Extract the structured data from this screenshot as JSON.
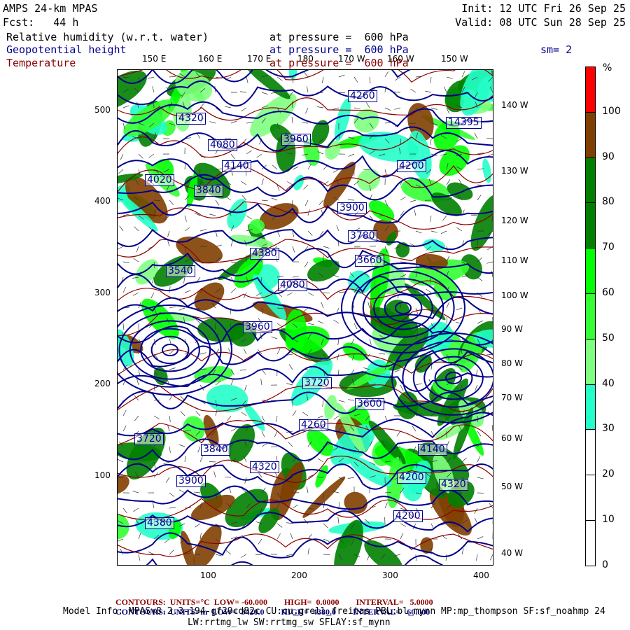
{
  "header": {
    "title": "AMPS 24-km MPAS",
    "fcst": "Fcst:   44 h",
    "init": "Init: 12 UTC Fri 26 Sep 25",
    "valid": "Valid: 08 UTC Sun 28 Sep 25",
    "fields": [
      {
        "name": "Relative humidity (w.r.t. water)",
        "level": "at pressure =  600 hPa",
        "color": "#000000"
      },
      {
        "name": "Geopotential height",
        "level": "at pressure =  600 hPa",
        "color": "#00008b"
      },
      {
        "name": "Temperature",
        "level": "at pressure =  600 hPa",
        "color": "#8b0000"
      }
    ],
    "smoothing": "sm= 2"
  },
  "axes": {
    "top_lon": [
      "150 E",
      "160 E",
      "170 E",
      "180",
      "170 W",
      "160 W",
      "150 W"
    ],
    "right_lon": [
      "140 W",
      "130 W",
      "120 W",
      "110 W",
      "100 W",
      "90 W",
      "80 W",
      "70 W",
      "60 W",
      "50 W",
      "40 W"
    ],
    "left_y": [
      "500",
      "400",
      "300",
      "200",
      "100"
    ],
    "bottom_x": [
      "100",
      "200",
      "300",
      "400"
    ]
  },
  "colorbar": {
    "unit": "%",
    "labels": [
      "100",
      "90",
      "80",
      "70",
      "60",
      "50",
      "40",
      "30",
      "20",
      "10",
      "0"
    ],
    "colors": [
      "#ff0000",
      "#7f3f00",
      "#007f00",
      "#007f00",
      "#00ff00",
      "#33ff33",
      "#80ff80",
      "#22ffc8",
      "#ffffff",
      "#ffffff",
      "#ffffff"
    ]
  },
  "contour_labels": [
    "4260",
    "4320",
    "14395",
    "4080",
    "4140",
    "3960",
    "4200",
    "4020",
    "3840",
    "3900",
    "3780",
    "3660",
    "3720",
    "3600",
    "4380",
    "3540",
    "4260",
    "4140",
    "4320",
    "4200",
    "3720",
    "3840",
    "3900",
    "3960",
    "4080",
    "4200",
    "4380",
    "4320"
  ],
  "footer": {
    "temp_contours": {
      "label": "CONTOURS:",
      "units": "UNITS=°C",
      "low": "LOW= -60.000",
      "high": "HIGH=  0.0000",
      "interval": "INTERVAL=   5.0000"
    },
    "hgt_contours": {
      "label": "CONTOURS:",
      "units": "UNITS=m",
      "low": "LOW=  3420.0",
      "high": "HIGH=  4380.0",
      "interval": "INTERVAL=   60.000"
    },
    "model_info": "Model Info: MPASv8.2.3-194-gf29cd82c CU:cu_grell_freitas PBL:bl_mynn MP:mp_thompson SF:sf_noahmp 24",
    "model_info2": "LW:rrtmg_lw SW:rrtmg_sw SFLAY:sf_mynn"
  }
}
